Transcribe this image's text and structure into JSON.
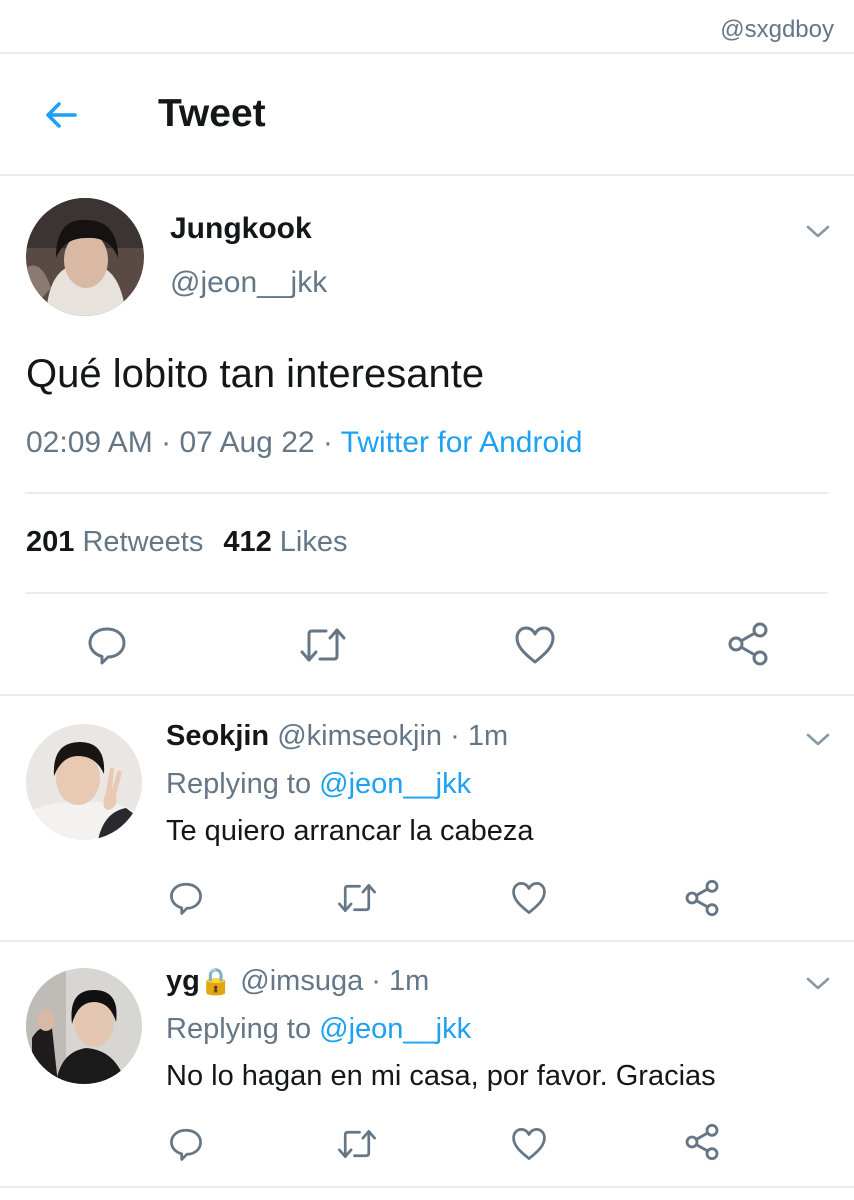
{
  "watermark": "@sxgdboy",
  "header": {
    "title": "Tweet",
    "back_icon": "arrow-left-icon"
  },
  "tweet": {
    "author_name": "Jungkook",
    "author_handle": "@jeon__jkk",
    "text": "Qué lobito tan interesante",
    "time": "02:09 AM",
    "date": "07 Aug 22",
    "separator": " · ",
    "source": "Twitter for Android",
    "retweets_count": "201",
    "retweets_label": "Retweets",
    "likes_count": "412",
    "likes_label": "Likes",
    "actions": [
      "reply-icon",
      "retweet-icon",
      "heart-icon",
      "share-icon"
    ]
  },
  "replies": [
    {
      "name": "Seokjin",
      "handle": "@kimseokjin",
      "time": "1m",
      "replying_prefix": "Replying to",
      "replying_to": "@jeon__jkk",
      "text": "Te quiero arrancar la cabeza"
    },
    {
      "name": "yg",
      "lock": "🔒",
      "handle": "@imsuga",
      "time": "1m",
      "replying_prefix": "Replying to",
      "replying_to": "@jeon__jkk",
      "text": "No lo hagan en mi casa, por favor. Gracias"
    }
  ],
  "colors": {
    "accent": "#1da1f2",
    "muted": "#657786",
    "text": "#14171a",
    "divider": "#e6ecf0"
  }
}
